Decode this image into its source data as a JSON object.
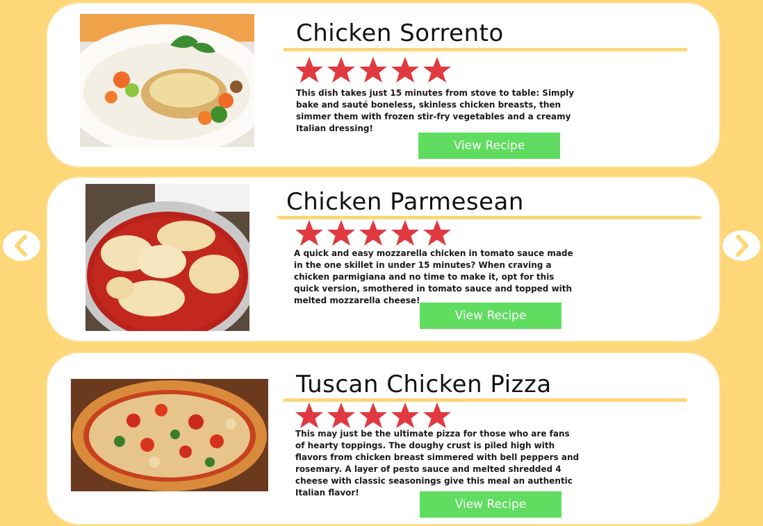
{
  "colors": {
    "background": "#fdd778",
    "card": "#ffffff",
    "button": "#60dd60",
    "star": "#e0393f"
  },
  "navigation": {
    "prev_icon": "chevron-left-icon",
    "next_icon": "chevron-right-icon"
  },
  "recipes": [
    {
      "title": "Chicken Sorrento",
      "rating": 5,
      "description": "This dish takes just 15 minutes from stove to table: Simply bake and sauté boneless, skinless chicken breasts, then simmer them with frozen stir-fry vegetables and a creamy Italian dressing!",
      "button_label": "View Recipe"
    },
    {
      "title": "Chicken Parmesean",
      "rating": 5,
      "description": "A quick and easy mozzarella chicken in tomato sauce made in the one skillet in under 15 minutes? When craving a chicken parmigiana and no time to make it, opt for this quick version, smothered in tomato sauce and topped with melted mozzarella cheese!",
      "button_label": "View Recipe"
    },
    {
      "title": "Tuscan Chicken Pizza",
      "rating": 5,
      "description": "This may just be the ultimate pizza for those who are fans of hearty toppings. The doughy crust is piled high with flavors from chicken breast simmered with bell peppers and rosemary. A layer of pesto sauce and melted shredded 4 cheese with classic seasonings give this meal an authentic Italian flavor!",
      "button_label": "View Recipe"
    }
  ]
}
